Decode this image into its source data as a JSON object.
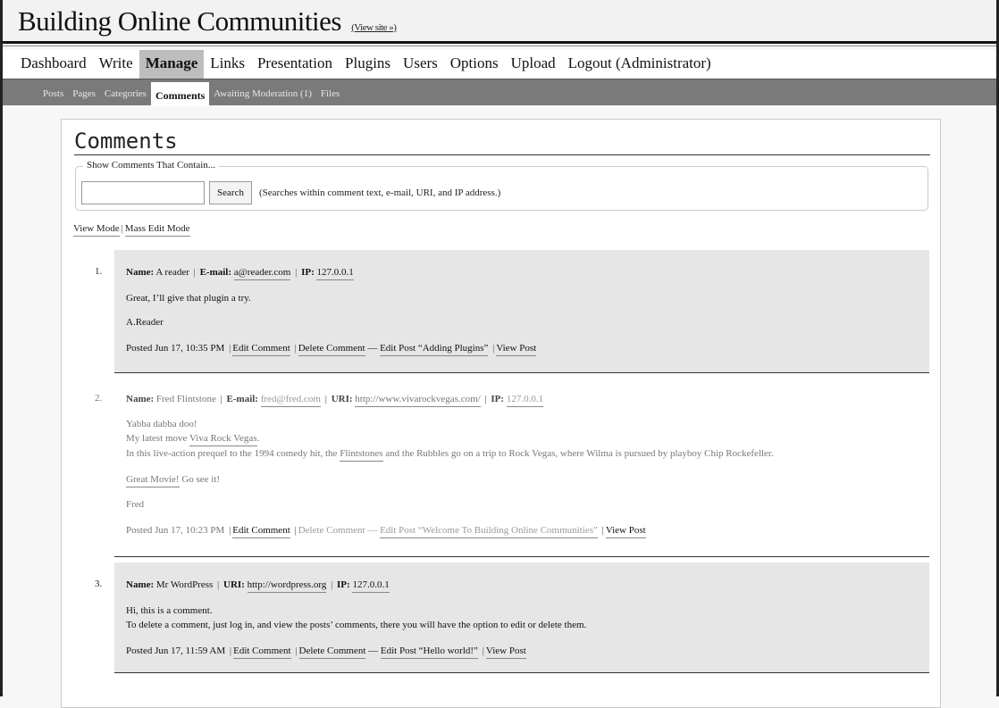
{
  "site": {
    "title": "Building Online Communities",
    "view_site": "(View site »)"
  },
  "nav": {
    "items": [
      "Dashboard",
      "Write",
      "Manage",
      "Links",
      "Presentation",
      "Plugins",
      "Users",
      "Options",
      "Upload",
      "Logout (Administrator)"
    ],
    "active": "Manage"
  },
  "subnav": {
    "items": [
      "Posts",
      "Pages",
      "Categories",
      "Comments",
      "Awaiting Moderation (1)",
      "Files"
    ],
    "active": "Comments"
  },
  "page": {
    "title": "Comments",
    "search_legend": "Show Comments That Contain...",
    "search_value": "",
    "search_button": "Search",
    "search_hint": "(Searches within comment text, e-mail, URI, and IP address.)",
    "view_mode": "View Mode",
    "mass_edit_mode": "Mass Edit Mode"
  },
  "labels": {
    "name": "Name:",
    "email": "E-mail:",
    "uri": "URI:",
    "ip": "IP:",
    "edit_comment": "Edit Comment",
    "delete_comment": "Delete Comment",
    "view_post": "View Post",
    "sep": "|",
    "dash": "—"
  },
  "comments": [
    {
      "number": "1.",
      "name": "A reader",
      "email": "a@reader.com",
      "ip": "127.0.0.1",
      "line1": "Great, I’ll give that plugin a try.",
      "line2": "A.Reader",
      "posted": "Posted Jun 17, 10:35 PM",
      "edit_post": "Edit Post “Adding Plugins”"
    },
    {
      "number": "2.",
      "name": "Fred Flintstone",
      "email": "fred@fred.com",
      "uri": "http://www.vivarockvegas.com/",
      "ip": "127.0.0.1",
      "line1": "Yabba dabba doo!",
      "line2_a": "My latest move ",
      "line2_link": "Viva Rock Vegas",
      "line2_b": ".",
      "line3_a": "In this live-action prequel to the 1994 comedy hit, the ",
      "line3_link": "Flintstones",
      "line3_b": " and the Rubbles go on a trip to Rock Vegas, where Wilma is pursued by playboy Chip Rockefeller.",
      "line4_link": "Great Movie!",
      "line4_b": " Go see it!",
      "line5": "Fred",
      "posted": "Posted Jun 17, 10:23 PM",
      "edit_post": "Edit Post “Welcome To Building Online Communities”"
    },
    {
      "number": "3.",
      "name": "Mr WordPress",
      "uri": "http://wordpress.org",
      "ip": "127.0.0.1",
      "line1": "Hi, this is a comment.",
      "line2": "To delete a comment, just log in, and view the posts’ comments, there you will have the option to edit or delete them.",
      "posted": "Posted Jun 17, 11:59 AM",
      "edit_post": "Edit Post “Hello world!”"
    }
  ]
}
